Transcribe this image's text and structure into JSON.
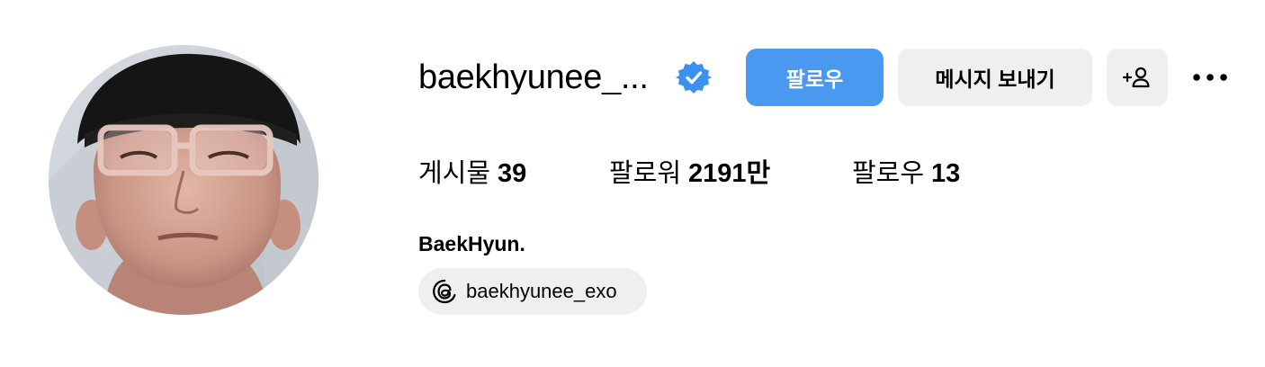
{
  "profile": {
    "username": "baekhyunee_...",
    "verified": true,
    "verified_badge_icon": "verified-badge-icon",
    "display_name": "BaekHyun.",
    "avatar": "profile-photo"
  },
  "actions": {
    "follow_label": "팔로우",
    "message_label": "메시지 보내기",
    "add_user_label": "+",
    "add_user_icon": "person-add-icon",
    "more_icon": "more-options-icon"
  },
  "stats": {
    "posts_label": "게시물",
    "posts_value": "39",
    "followers_label": "팔로워",
    "followers_value": "2191만",
    "following_label": "팔로우",
    "following_value": "13"
  },
  "threads": {
    "icon": "threads-icon",
    "handle": "baekhyunee_exo"
  },
  "colors": {
    "follow_button": "#4a99f0",
    "secondary_button": "#efefef",
    "verified_badge": "#3b90f0"
  }
}
